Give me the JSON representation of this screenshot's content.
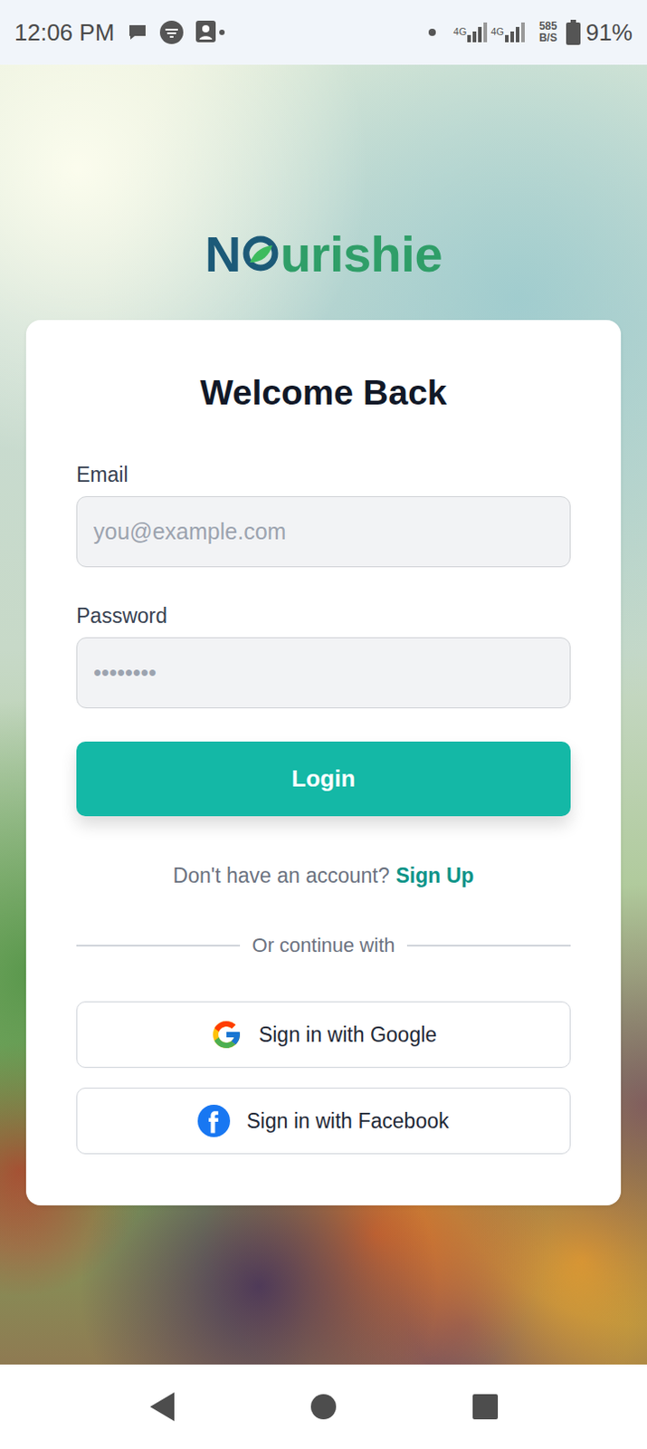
{
  "status_bar": {
    "time": "12:06 PM",
    "network": [
      "4G",
      "4G"
    ],
    "speed": {
      "value": "585",
      "unit": "B/S"
    },
    "battery": "91%"
  },
  "logo": {
    "before": "N",
    "after": "urishie"
  },
  "form": {
    "title": "Welcome Back",
    "fields": [
      {
        "label": "Email",
        "placeholder": "you@example.com",
        "kind": "email"
      },
      {
        "label": "Password",
        "placeholder": "••••••••",
        "kind": "password"
      }
    ],
    "submit": "Login"
  },
  "signup": {
    "prompt": "Don't have an account?",
    "link": "Sign Up"
  },
  "divider": "Or continue with",
  "social": [
    {
      "label": "Sign in with Google",
      "kind": "google"
    },
    {
      "label": "Sign in with Facebook",
      "kind": "facebook"
    }
  ]
}
